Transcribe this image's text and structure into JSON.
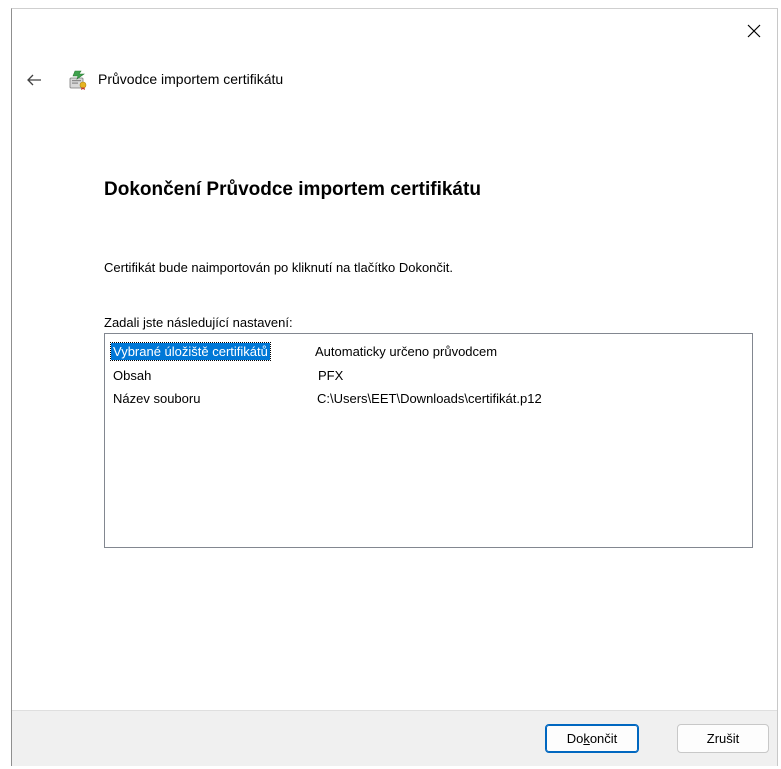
{
  "wizard": {
    "title": "Průvodce importem certifikátu",
    "heading": "Dokončení Průvodce importem certifikátu",
    "info": "Certifikát bude naimportován po kliknutí na tlačítko Dokončit.",
    "settings_label": "Zadali jste následující nastavení:"
  },
  "settings": [
    {
      "key": "Vybrané úložiště certifikátů",
      "value": "Automaticky určeno průvodcem",
      "selected": true
    },
    {
      "key": "Obsah",
      "value": "PFX",
      "selected": false
    },
    {
      "key": "Název souboru",
      "value": "C:\\Users\\EET\\Downloads\\certifikát.p12",
      "selected": false
    }
  ],
  "buttons": {
    "finish_pre": "Do",
    "finish_mnemonic": "k",
    "finish_post": "ončit",
    "cancel": "Zrušit"
  },
  "colors": {
    "accent": "#0078d7",
    "footer_bg": "#f0f0f0"
  }
}
